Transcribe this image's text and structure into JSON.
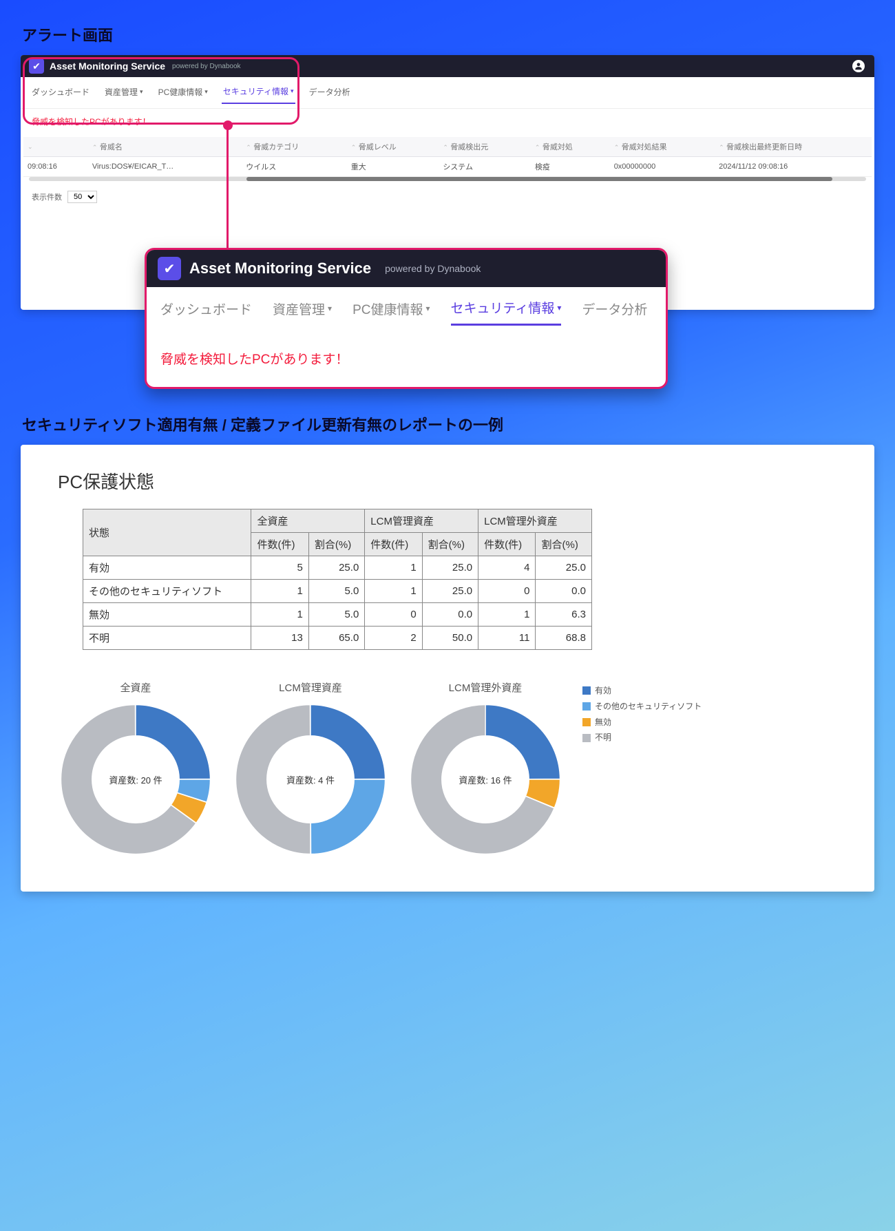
{
  "section1_title": "アラート画面",
  "section2_title": "セキュリティソフト適用有無 / 定義ファイル更新有無のレポートの一例",
  "app": {
    "title": "Asset Monitoring Service",
    "powered": "powered by Dynabook",
    "tabs": {
      "dashboard": "ダッシュボード",
      "asset": "資産管理",
      "health": "PC健康情報",
      "security": "セキュリティ情報",
      "analytics": "データ分析"
    },
    "alert_message": "脅威を検知したPCがあります！",
    "columns": {
      "c0": "",
      "c1": "脅威名",
      "c2": "脅威カテゴリ",
      "c3": "脅威レベル",
      "c4": "脅威検出元",
      "c5": "脅威対処",
      "c6": "脅威対処結果",
      "c7": "脅威検出最終更新日時"
    },
    "row": {
      "time": "09:08:16",
      "name": "Virus:DOS¥/EICAR_T…",
      "category": "ウイルス",
      "level": "重大",
      "source": "システム",
      "action": "検疫",
      "result": "0x00000000",
      "updated": "2024/11/12 09:08:16"
    },
    "perpage_label": "表示件数",
    "perpage_value": "50"
  },
  "report": {
    "title": "PC保護状態",
    "header_groups": {
      "state": "状態",
      "all": "全資産",
      "lcm": "LCM管理資産",
      "nonlcm": "LCM管理外資産"
    },
    "sub_headers": {
      "count": "件数(件)",
      "ratio": "割合(%)"
    },
    "rows": {
      "r0": {
        "label": "有効",
        "all_c": "5",
        "all_r": "25.0",
        "lcm_c": "1",
        "lcm_r": "25.0",
        "non_c": "4",
        "non_r": "25.0"
      },
      "r1": {
        "label": "その他のセキュリティソフト",
        "all_c": "1",
        "all_r": "5.0",
        "lcm_c": "1",
        "lcm_r": "25.0",
        "non_c": "0",
        "non_r": "0.0"
      },
      "r2": {
        "label": "無効",
        "all_c": "1",
        "all_r": "5.0",
        "lcm_c": "0",
        "lcm_r": "0.0",
        "non_c": "1",
        "non_r": "6.3"
      },
      "r3": {
        "label": "不明",
        "all_c": "13",
        "all_r": "65.0",
        "lcm_c": "2",
        "lcm_r": "50.0",
        "non_c": "11",
        "non_r": "68.8"
      }
    },
    "charts": {
      "c0": {
        "title": "全資産",
        "center": "資産数: 20 件"
      },
      "c1": {
        "title": "LCM管理資産",
        "center": "資産数: 4 件"
      },
      "c2": {
        "title": "LCM管理外資産",
        "center": "資産数: 16 件"
      }
    },
    "legend": {
      "l0": "有効",
      "l1": "その他のセキュリティソフト",
      "l2": "無効",
      "l3": "不明"
    }
  },
  "colors": {
    "enabled": "#3e79c5",
    "other": "#5ea6e6",
    "disabled": "#f2a629",
    "unknown": "#b9bcc2"
  },
  "chart_data": [
    {
      "type": "pie",
      "title": "全資産",
      "center_label": "資産数: 20 件",
      "series": [
        {
          "name": "有効",
          "value": 5,
          "percent": 25.0
        },
        {
          "name": "その他のセキュリティソフト",
          "value": 1,
          "percent": 5.0
        },
        {
          "name": "無効",
          "value": 1,
          "percent": 5.0
        },
        {
          "name": "不明",
          "value": 13,
          "percent": 65.0
        }
      ]
    },
    {
      "type": "pie",
      "title": "LCM管理資産",
      "center_label": "資産数: 4 件",
      "series": [
        {
          "name": "有効",
          "value": 1,
          "percent": 25.0
        },
        {
          "name": "その他のセキュリティソフト",
          "value": 1,
          "percent": 25.0
        },
        {
          "name": "無効",
          "value": 0,
          "percent": 0.0
        },
        {
          "name": "不明",
          "value": 2,
          "percent": 50.0
        }
      ]
    },
    {
      "type": "pie",
      "title": "LCM管理外資産",
      "center_label": "資産数: 16 件",
      "series": [
        {
          "name": "有効",
          "value": 4,
          "percent": 25.0
        },
        {
          "name": "その他のセキュリティソフト",
          "value": 0,
          "percent": 0.0
        },
        {
          "name": "無効",
          "value": 1,
          "percent": 6.3
        },
        {
          "name": "不明",
          "value": 11,
          "percent": 68.8
        }
      ]
    }
  ]
}
